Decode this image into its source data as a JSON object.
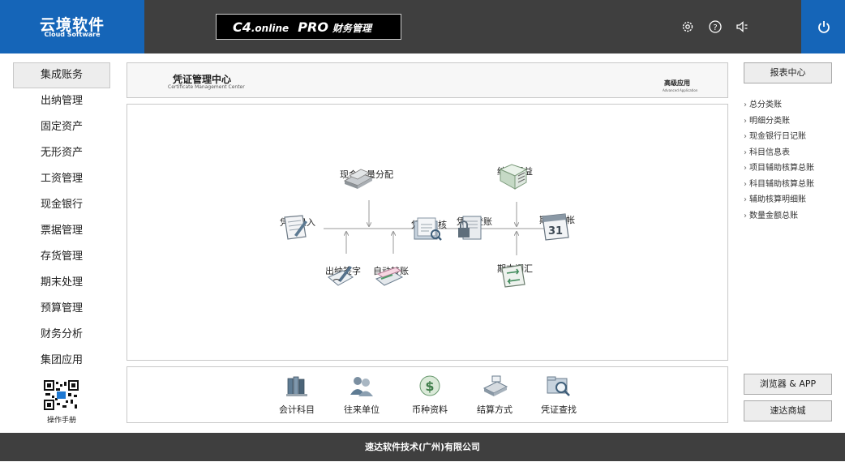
{
  "header": {
    "logo_cn": "云境软件",
    "logo_en": "Cloud Software",
    "product_version": "C4",
    "product_edition": ".online",
    "product_tier": "PRO",
    "product_module": "财务管理",
    "icons": [
      "gear-icon",
      "help-icon",
      "speaker-icon",
      "power-icon"
    ]
  },
  "nav": {
    "items": [
      "集成账务",
      "出纳管理",
      "固定资产",
      "无形资产",
      "工资管理",
      "现金银行",
      "票据管理",
      "存货管理",
      "期末处理",
      "预算管理",
      "财务分析",
      "集团应用"
    ],
    "manual_label": "操作手册"
  },
  "center": {
    "title_cn": "凭证管理中心",
    "title_en": "Certificate Management Center",
    "advanced_cn": "高级应用",
    "advanced_en": "Advanced Application"
  },
  "flow": {
    "cash_flow": "现金流量分配",
    "transfer_pl": "结转损益",
    "voucher_entry": "凭证录入",
    "voucher_audit": "凭证审核",
    "voucher_post": "凭证登账",
    "period_close": "期末结帐",
    "cashier_sign": "出纳签字",
    "auto_transfer": "自动转账",
    "period_adjust": "期末调汇",
    "calendar_day": "31"
  },
  "tools": [
    "会计科目",
    "往来单位",
    "币种资料",
    "结算方式",
    "凭证查找"
  ],
  "right": {
    "report_center": "报表中心",
    "links": [
      "总分类账",
      "明细分类账",
      "现金银行日记账",
      "科目信息表",
      "项目辅助核算总账",
      "科目辅助核算总账",
      "辅助核算明细账",
      "数量金额总账"
    ],
    "browser_app": "浏览器 & APP",
    "mall": "速达商城"
  },
  "footer": {
    "company": "速达软件技术(广州)有限公司"
  },
  "colors": {
    "brand_blue": "#1565b8",
    "header_dark": "#3f3f3f",
    "panel_border": "#c8c8c8"
  }
}
